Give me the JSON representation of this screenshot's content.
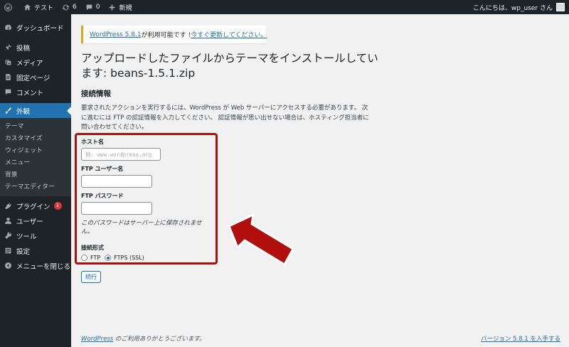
{
  "adminbar": {
    "site_name": "テスト",
    "updates_count": "6",
    "comments_count": "0",
    "new_label": "新規",
    "greeting": "こんにちは、wp_user さん"
  },
  "sidebar": {
    "items": [
      {
        "label": "ダッシュボード",
        "icon": "dashboard-icon"
      },
      {
        "label": "投稿",
        "icon": "pin-icon"
      },
      {
        "label": "メディア",
        "icon": "media-icon"
      },
      {
        "label": "固定ページ",
        "icon": "page-icon"
      },
      {
        "label": "コメント",
        "icon": "comment-icon"
      },
      {
        "label": "外観",
        "icon": "brush-icon"
      }
    ],
    "submenu": [
      "テーマ",
      "カスタマイズ",
      "ウィジェット",
      "メニュー",
      "背景",
      "テーマエディター"
    ],
    "items_after": [
      {
        "label": "プラグイン",
        "badge": "1",
        "icon": "plugin-icon"
      },
      {
        "label": "ユーザー",
        "icon": "user-icon"
      },
      {
        "label": "ツール",
        "icon": "wrench-icon"
      },
      {
        "label": "設定",
        "icon": "settings-icon"
      },
      {
        "label": "メニューを閉じる",
        "icon": "collapse-icon"
      }
    ]
  },
  "notice": {
    "link": "WordPress 5.8.1",
    "text": " が利用可能です ! ",
    "update_link": "今すぐ更新してください。"
  },
  "page": {
    "title": "アップロードしたファイルからテーマをインストールしています: beans-1.5.1.zip",
    "section_title": "接続情報",
    "description": "要求されたアクションを実行するには、WordPress が Web サーバーにアクセスする必要があります。 次に進むには FTP の認証情報を入力してください。 認証情報が思い出せない場合は、ホスティング担当者に問い合わせてください。"
  },
  "form": {
    "host_label": "ホスト名",
    "host_placeholder": "例: www.wordpress.org",
    "user_label": "FTP ユーザー名",
    "user_value": "",
    "pass_label": "FTP パスワード",
    "pass_value": "",
    "pass_hint": "このパスワードはサーバー上に保存されません。",
    "conn_label": "接続形式",
    "opt_ftp": "FTP",
    "opt_ftps": "FTPS (SSL)",
    "submit": "続行"
  },
  "footer": {
    "wp_link": "WordPress",
    "thanks": " のご利用ありがとうございます。",
    "version": "バージョン 5.8.1 を入手する"
  },
  "colors": {
    "accent": "#2271b1",
    "highlight": "#b10e0e",
    "sidebar": "#1d2327"
  }
}
